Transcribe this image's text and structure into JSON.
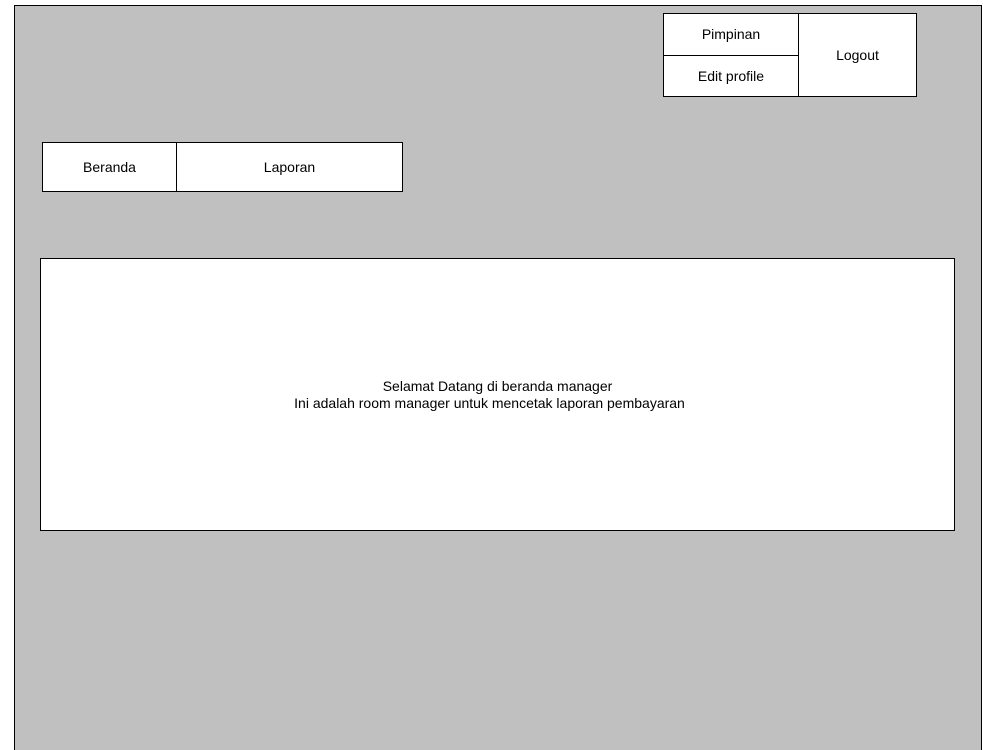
{
  "user_menu": {
    "role_label": "Pimpinan",
    "edit_profile_label": "Edit profile",
    "logout_label": "Logout"
  },
  "nav": {
    "items": [
      {
        "label": "Beranda"
      },
      {
        "label": "Laporan"
      }
    ]
  },
  "content": {
    "welcome_line": "Selamat Datang di beranda manager",
    "description_line": "Ini adalah room manager untuk mencetak laporan pembayaran"
  },
  "colors": {
    "canvas_background": "#c0c0c0",
    "panel_background": "#ffffff",
    "border": "#000000"
  }
}
